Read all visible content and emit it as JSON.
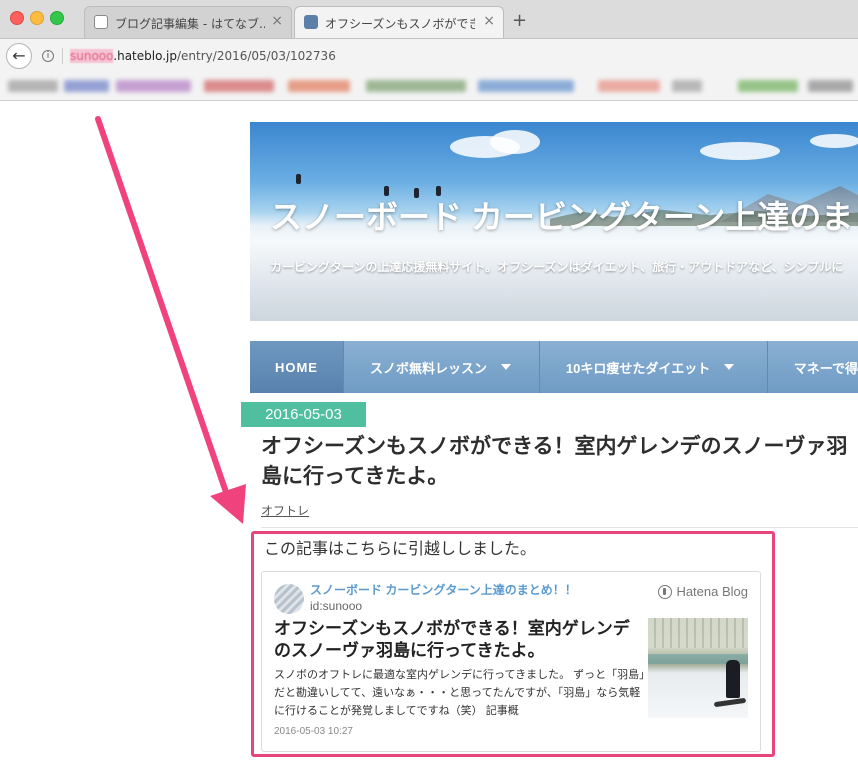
{
  "browser": {
    "tabs": [
      {
        "title": "ブログ記事編集 - はてなブ...",
        "active": false
      },
      {
        "title": "オフシーズンもスノボができ...",
        "active": true
      }
    ],
    "new_tab_label": "+",
    "close_label": "×",
    "back_label": "←",
    "info_label": "i",
    "url_blurred": "sunooo",
    "url_host": ".hateblo.jp",
    "url_path": "/entry/2016/05/03/102736"
  },
  "blog": {
    "title": "スノーボード カービングターン上達のまとめ！！",
    "description": "カービングターンの上達応援無料サイト。オフシーズンはダイエット、旅行・アウトドアなど、シンプルに",
    "nav": [
      {
        "label": "HOME"
      },
      {
        "label": "スノボ無料レッスン"
      },
      {
        "label": "10キロ痩せたダイエット"
      },
      {
        "label": "マネーで得"
      }
    ]
  },
  "entry": {
    "date": "2016-05-03",
    "title": "オフシーズンもスノボができる！室内ゲレンデのスノーヴァ羽島に行ってきたよ。",
    "category": "オフトレ",
    "moved_notice": "この記事はこちらに引越ししました。"
  },
  "embed_card": {
    "blog_name": "スノーボード カービングターン上達のまとめ！！",
    "user_id": "id:sunooo",
    "service": "Hatena Blog",
    "title": "オフシーズンもスノボができる！室内ゲレンデのスノーヴァ羽島に行ってきたよ。",
    "excerpt": "スノボのオフトレに最適な室内ゲレンデに行ってきました。 ずっと「羽島」だと勘違いしてて、遠いなぁ・・・と思ってたんですが、「羽島」なら気軽に行けることが発覚しましてですね（笑） 記事概",
    "timestamp": "2016-05-03 10:27"
  },
  "colors": {
    "annotation": "#e8457f",
    "date_badge": "#4fbf9f",
    "nav": "#7aa3ca",
    "link": "#5b9bd1"
  }
}
